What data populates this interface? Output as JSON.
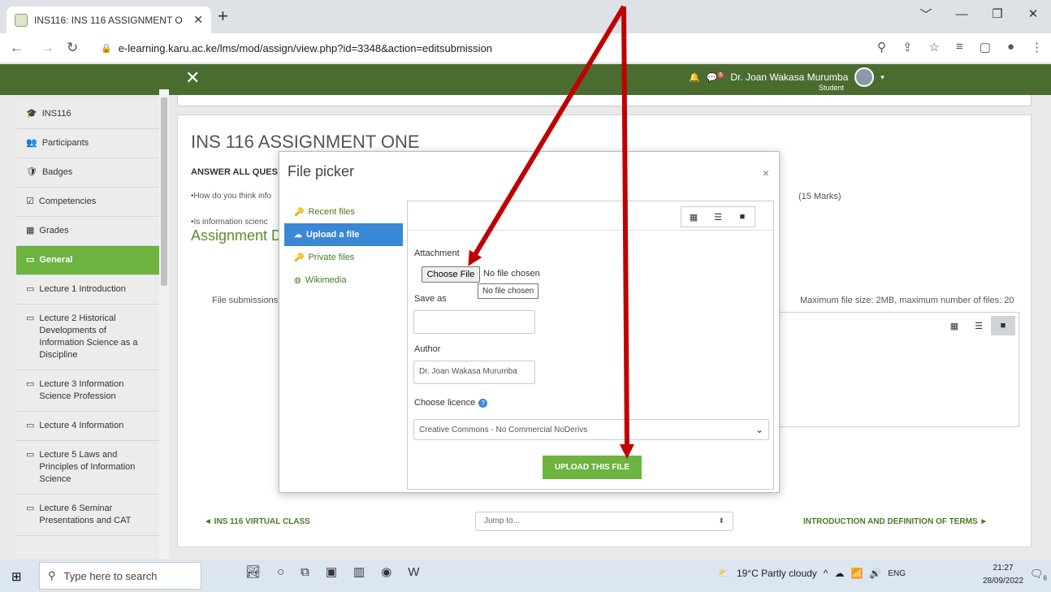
{
  "browser": {
    "tab_title": "INS116: INS 116 ASSIGNMENT O",
    "tab_close": "✕",
    "new_tab": "+",
    "url": "e-learning.karu.ac.ke/lms/mod/assign/view.php?id=3348&action=editsubmission",
    "window_controls": [
      "﹀",
      "—",
      "❐",
      "✕"
    ]
  },
  "header": {
    "menu_icon": "✕",
    "user_name": "Dr. Joan Wakasa Murumba",
    "user_role": "Student",
    "notification_count": "5"
  },
  "sidebar": {
    "items": [
      {
        "icon": "🎓",
        "label": "INS116"
      },
      {
        "icon": "👥",
        "label": "Participants"
      },
      {
        "icon": "🛡",
        "label": "Badges"
      },
      {
        "icon": "☑",
        "label": "Competencies"
      },
      {
        "icon": "▦",
        "label": "Grades"
      },
      {
        "icon": "▭",
        "label": "General"
      },
      {
        "icon": "▭",
        "label": "Lecture 1 Introduction"
      },
      {
        "icon": "▭",
        "label": "Lecture 2 Historical Developments of Information Science as a Discipline"
      },
      {
        "icon": "▭",
        "label": "Lecture 3 Information Science Profession"
      },
      {
        "icon": "▭",
        "label": "Lecture 4 Information"
      },
      {
        "icon": "▭",
        "label": "Lecture 5 Laws and Principles of Information Science"
      },
      {
        "icon": "▭",
        "label": "Lecture 6 Seminar Presentations and CAT"
      }
    ],
    "active_index": 5
  },
  "main": {
    "title": "INS 116 ASSIGNMENT ONE",
    "answer_all": "ANSWER ALL QUES",
    "question1": "•How do you think info",
    "marks": "(15 Marks)",
    "question2": "•Is information scienc",
    "details_heading": "Assignment D",
    "file_submissions": "File submissions",
    "max_size": "Maximum file size: 2MB, maximum number of files: 20",
    "prev_activity": "◄ INS 116 VIRTUAL CLASS",
    "jump_to": "Jump to...",
    "next_activity": "INTRODUCTION AND DEFINITION OF TERMS ►"
  },
  "file_picker": {
    "title": "File picker",
    "close": "×",
    "repositories": [
      {
        "label": "Recent files",
        "icon": "🔑"
      },
      {
        "label": "Upload a file",
        "icon": "☁"
      },
      {
        "label": "Private files",
        "icon": "🔑"
      },
      {
        "label": "Wikimedia",
        "icon": "◍"
      }
    ],
    "attachment_label": "Attachment",
    "choose_file": "Choose File",
    "no_file": "No file chosen",
    "tooltip": "No file chosen",
    "save_as_label": "Save as",
    "save_as_value": "",
    "author_label": "Author",
    "author_value": "Dr. Joan Wakasa Murumba",
    "licence_label": "Choose licence",
    "licence_value": "Creative Commons - No Commercial NoDerivs",
    "upload_button": "UPLOAD THIS FILE"
  },
  "taskbar": {
    "search_placeholder": "Type here to search",
    "weather": "19°C  Partly cloudy",
    "language": "ENG",
    "time": "21:27",
    "date": "28/09/2022",
    "notification_badge": "6"
  }
}
